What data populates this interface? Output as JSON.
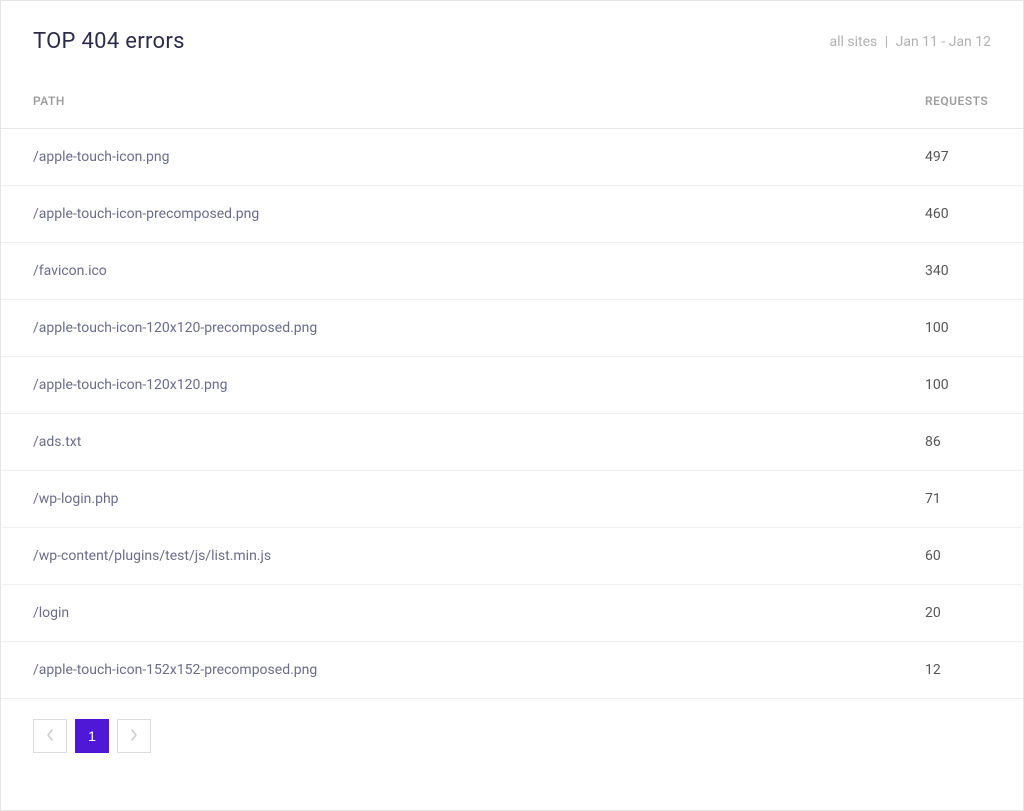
{
  "header": {
    "title": "TOP 404 errors",
    "filter_sites": "all sites",
    "filter_separator": "|",
    "filter_daterange": "Jan 11 - Jan 12"
  },
  "table": {
    "columns": {
      "path": "PATH",
      "requests": "REQUESTS"
    },
    "rows": [
      {
        "path": "/apple-touch-icon.png",
        "requests": "497"
      },
      {
        "path": "/apple-touch-icon-precomposed.png",
        "requests": "460"
      },
      {
        "path": "/favicon.ico",
        "requests": "340"
      },
      {
        "path": "/apple-touch-icon-120x120-precomposed.png",
        "requests": "100"
      },
      {
        "path": "/apple-touch-icon-120x120.png",
        "requests": "100"
      },
      {
        "path": "/ads.txt",
        "requests": "86"
      },
      {
        "path": "/wp-login.php",
        "requests": "71"
      },
      {
        "path": "/wp-content/plugins/test/js/list.min.js",
        "requests": "60"
      },
      {
        "path": "/login",
        "requests": "20"
      },
      {
        "path": "/apple-touch-icon-152x152-precomposed.png",
        "requests": "12"
      }
    ]
  },
  "pagination": {
    "current": "1"
  }
}
